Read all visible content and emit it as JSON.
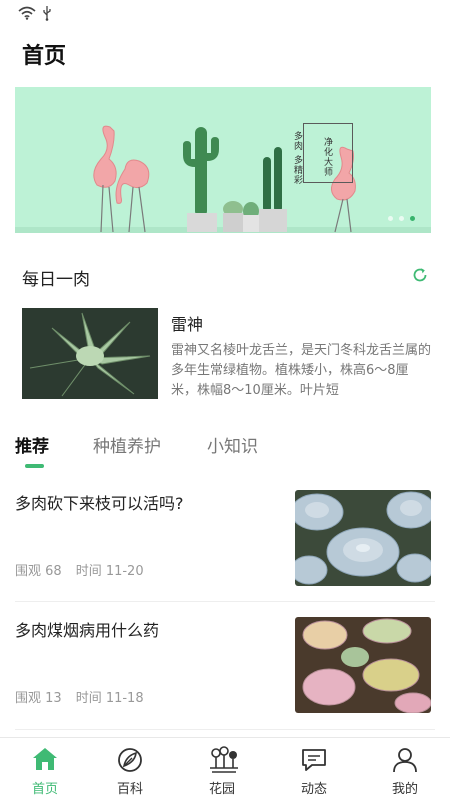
{
  "status_bar": {
    "wifi_icon": "wifi-icon",
    "usb_icon": "usb-icon"
  },
  "header": {
    "title": "首页"
  },
  "banner": {
    "poster_line1": "多肉 多精彩",
    "poster_line2": "净化大师",
    "dots": 3,
    "active_dot": 2
  },
  "daily": {
    "section_title": "每日一肉",
    "refresh_icon": "refresh-icon",
    "plant_name": "雷神",
    "description": "雷神又名棱叶龙舌兰，是天门冬科龙舌兰属的多年生常绿植物。植株矮小，株高6～8厘米，株幅8～10厘米。叶片短"
  },
  "tabs": [
    {
      "label": "推荐",
      "active": true
    },
    {
      "label": "种植养护",
      "active": false
    },
    {
      "label": "小知识",
      "active": false
    }
  ],
  "articles": [
    {
      "title": "多肉砍下来枝可以活吗?",
      "views_label": "围观 68",
      "time_label": "时间 11-20"
    },
    {
      "title": "多肉煤烟病用什么药",
      "views_label": "围观 13",
      "time_label": "时间 11-18"
    }
  ],
  "bottom_nav": [
    {
      "label": "首页",
      "icon": "home-icon",
      "active": true
    },
    {
      "label": "百科",
      "icon": "encyclopedia-icon",
      "active": false
    },
    {
      "label": "花园",
      "icon": "garden-icon",
      "active": false
    },
    {
      "label": "动态",
      "icon": "chat-icon",
      "active": false
    },
    {
      "label": "我的",
      "icon": "profile-icon",
      "active": false
    }
  ],
  "colors": {
    "accent": "#3fba74",
    "banner_bg": "#bdf2d6",
    "muted_text": "#999999"
  }
}
